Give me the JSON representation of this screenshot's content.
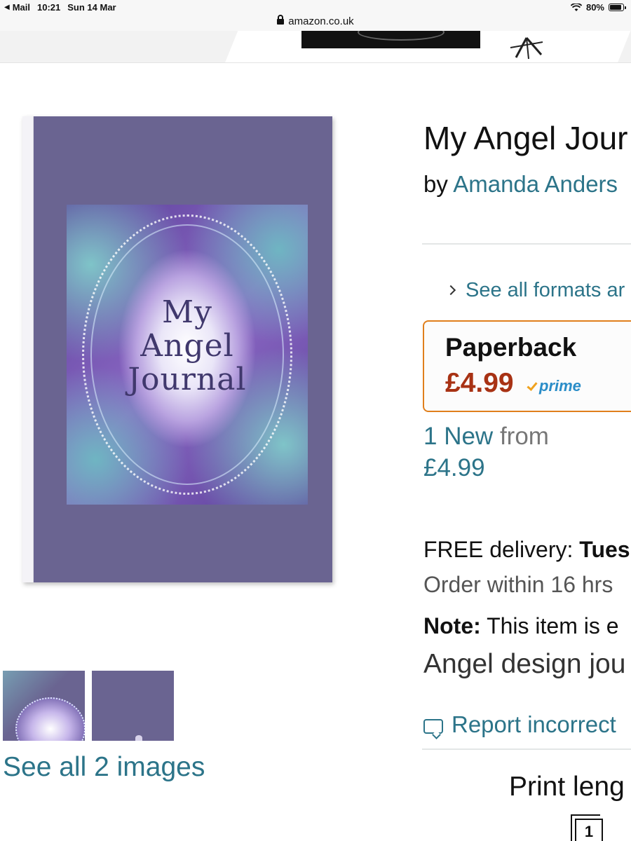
{
  "status_bar": {
    "back_app": "Mail",
    "time": "10:21",
    "date": "Sun 14 Mar",
    "battery": "80%"
  },
  "browser": {
    "url": "amazon.co.uk"
  },
  "product": {
    "title": "My Angel Jour",
    "by_prefix": "by",
    "author": "Amanda Anders",
    "cover_title_lines": [
      "My",
      "Angel",
      "Journal"
    ],
    "see_all_images": "See all 2 images"
  },
  "formats": {
    "link": "See all formats ar"
  },
  "buy_box": {
    "format": "Paperback",
    "price": "£4.99",
    "prime": "prime"
  },
  "offers": {
    "count": "1 New",
    "from": "from",
    "price": "£4.99"
  },
  "delivery": {
    "label": "FREE delivery:",
    "day": "Tues",
    "order_within": "Order within 16 hrs"
  },
  "note": {
    "label": "Note:",
    "text": "This item is e",
    "description": "Angel design jou"
  },
  "report": {
    "label": "Report incorrect"
  },
  "details": {
    "print_length": "Print leng",
    "page_icon_number": "1"
  },
  "colors": {
    "link": "#2c7489",
    "price": "#a83214",
    "buy_box_border": "#e07f1c",
    "cover": "#6a6491",
    "prime": "#2a8dc8"
  },
  "icons": [
    "wifi-icon",
    "battery-icon",
    "lock-icon",
    "chevron-right-icon",
    "prime-check-icon",
    "speech-bubble-icon",
    "pages-icon"
  ]
}
